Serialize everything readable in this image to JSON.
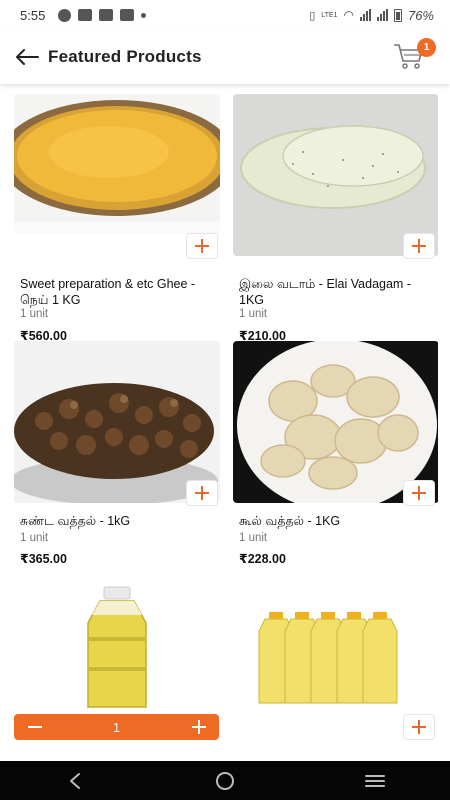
{
  "status_bar": {
    "time": "5:55",
    "battery": "76%",
    "network": "LTE1"
  },
  "header": {
    "title": "Featured Products",
    "cart_count": "1"
  },
  "products": [
    {
      "name": "Sweet preparation & etc Ghee - நெய் 1 KG",
      "unit": "1 unit",
      "price": "₹560.00",
      "image": "ghee-bowl"
    },
    {
      "name": "இலை வடாம் - Elai Vadagam - 1KG",
      "unit": "1 unit",
      "price": "₹210.00",
      "image": "elai-vadagam"
    },
    {
      "name": "சுண்ட வத்தல் - 1kG",
      "unit": "1 unit",
      "price": "₹365.00",
      "image": "sundakkai"
    },
    {
      "name": "கூல் வத்தல் - 1KG",
      "unit": "1 unit",
      "price": "₹228.00",
      "image": "koozh-vathal"
    },
    {
      "name": "",
      "image": "oil-bottle",
      "quantity": "1"
    },
    {
      "name": "",
      "image": "oil-bottles-pack"
    }
  ],
  "icons": {
    "back": "back-arrow-icon",
    "cart": "cart-icon",
    "add": "plus-icon",
    "nav_back": "nav-back-icon",
    "nav_home": "nav-home-icon",
    "nav_recents": "nav-recents-icon"
  },
  "colors": {
    "accent": "#ee6a25",
    "nav_bar": "#050505"
  }
}
